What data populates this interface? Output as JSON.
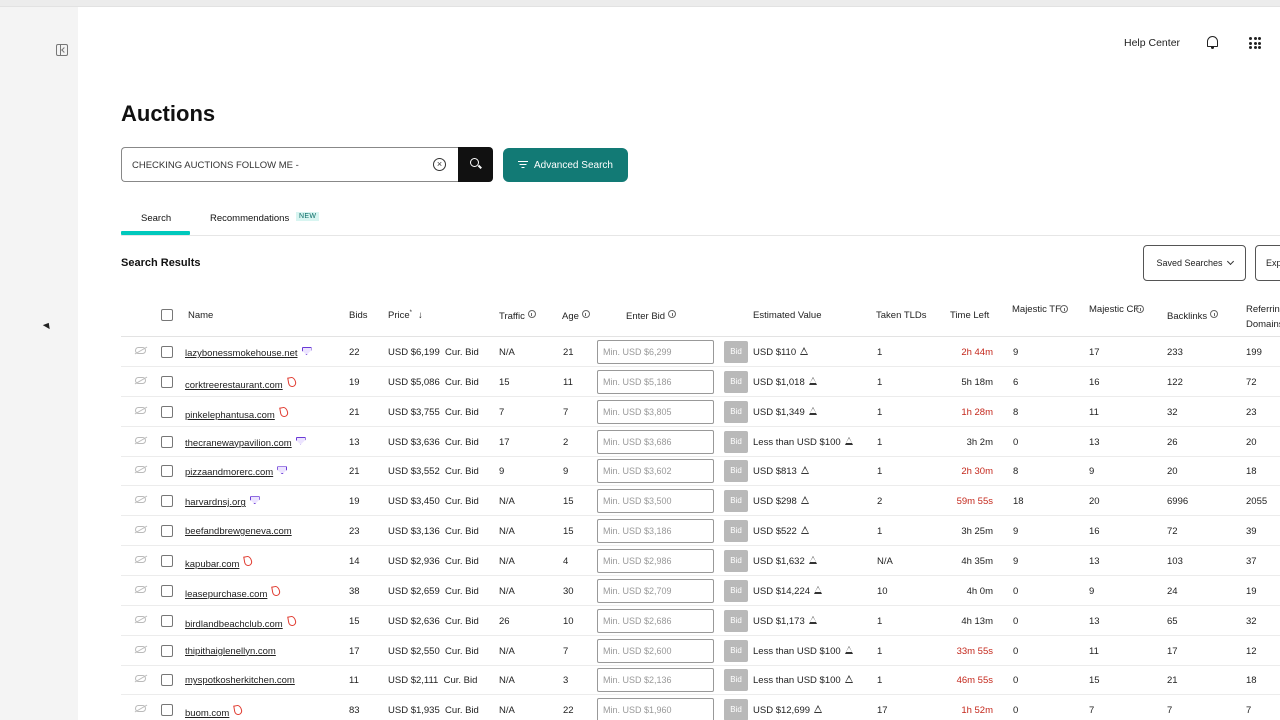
{
  "topbar": {
    "help_label": "Help Center"
  },
  "page": {
    "title": "Auctions"
  },
  "search": {
    "value": "CHECKING AUCTIONS FOLLOW ME -",
    "clear_glyph": "×"
  },
  "advanced_search_label": "Advanced Search",
  "tabs": [
    {
      "label": "Search",
      "active": true
    },
    {
      "label": "Recommendations",
      "badge": "NEW"
    }
  ],
  "results": {
    "title": "Search Results",
    "saved_searches_label": "Saved Searches",
    "export_label": "Exp"
  },
  "columns": {
    "name": "Name",
    "bids": "Bids",
    "price": "Price",
    "price_marker": "*",
    "traffic": "Traffic",
    "age": "Age",
    "enter_bid": "Enter Bid",
    "estimated_value": "Estimated Value",
    "taken_tlds": "Taken TLDs",
    "time_left": "Time Left",
    "majestic_tf": "Majestic TF",
    "majestic_cf": "Majestic CF",
    "backlinks": "Backlinks",
    "referring_domains": "Referring Domains"
  },
  "bid_button_label": "Bid",
  "cur_bid_label": "Cur. Bid",
  "colors": {
    "accent": "#127a75",
    "tab_underline": "#00c9bd",
    "urgent": "#c4281c"
  },
  "rows": [
    {
      "domain": "lazybonessmokehouse.net",
      "icon": "diamond-icon",
      "bids": "22",
      "price": "USD $6,199",
      "traffic": "N/A",
      "age": "21",
      "min_bid": "Min. USD $6,299",
      "est_value": "USD $110",
      "taken_tlds": "1",
      "time_left": "2h 44m",
      "urgent": true,
      "tf": "9",
      "cf": "17",
      "backlinks": "233",
      "ref_domains": "199"
    },
    {
      "domain": "corktreerestaurant.com",
      "icon": "fire-icon",
      "bids": "19",
      "price": "USD $5,086",
      "traffic": "15",
      "age": "11",
      "min_bid": "Min. USD $5,186",
      "est_value": "USD $1,018",
      "taken_tlds": "1",
      "time_left": "5h 18m",
      "urgent": false,
      "tf": "6",
      "cf": "16",
      "backlinks": "122",
      "ref_domains": "72"
    },
    {
      "domain": "pinkelephantusa.com",
      "icon": "fire-icon",
      "bids": "21",
      "price": "USD $3,755",
      "traffic": "7",
      "age": "7",
      "min_bid": "Min. USD $3,805",
      "est_value": "USD $1,349",
      "taken_tlds": "1",
      "time_left": "1h 28m",
      "urgent": true,
      "tf": "8",
      "cf": "11",
      "backlinks": "32",
      "ref_domains": "23"
    },
    {
      "domain": "thecranewaypavilion.com",
      "icon": "diamond-icon",
      "bids": "13",
      "price": "USD $3,636",
      "traffic": "17",
      "age": "2",
      "min_bid": "Min. USD $3,686",
      "est_value": "Less than USD $100",
      "taken_tlds": "1",
      "time_left": "3h 2m",
      "urgent": false,
      "tf": "0",
      "cf": "13",
      "backlinks": "26",
      "ref_domains": "20"
    },
    {
      "domain": "pizzaandmorerc.com",
      "icon": "diamond-icon",
      "bids": "21",
      "price": "USD $3,552",
      "traffic": "9",
      "age": "9",
      "min_bid": "Min. USD $3,602",
      "est_value": "USD $813",
      "taken_tlds": "1",
      "time_left": "2h 30m",
      "urgent": true,
      "tf": "8",
      "cf": "9",
      "backlinks": "20",
      "ref_domains": "18"
    },
    {
      "domain": "harvardnsj.org",
      "icon": "diamond-icon",
      "bids": "19",
      "price": "USD $3,450",
      "traffic": "N/A",
      "age": "15",
      "min_bid": "Min. USD $3,500",
      "est_value": "USD $298",
      "taken_tlds": "2",
      "time_left": "59m 55s",
      "urgent": true,
      "tf": "18",
      "cf": "20",
      "backlinks": "6996",
      "ref_domains": "2055"
    },
    {
      "domain": "beefandbrewgeneva.com",
      "icon": "",
      "bids": "23",
      "price": "USD $3,136",
      "traffic": "N/A",
      "age": "15",
      "min_bid": "Min. USD $3,186",
      "est_value": "USD $522",
      "taken_tlds": "1",
      "time_left": "3h 25m",
      "urgent": false,
      "tf": "9",
      "cf": "16",
      "backlinks": "72",
      "ref_domains": "39"
    },
    {
      "domain": "kapubar.com",
      "icon": "fire-icon",
      "bids": "14",
      "price": "USD $2,936",
      "traffic": "N/A",
      "age": "4",
      "min_bid": "Min. USD $2,986",
      "est_value": "USD $1,632",
      "taken_tlds": "N/A",
      "time_left": "4h 35m",
      "urgent": false,
      "tf": "9",
      "cf": "13",
      "backlinks": "103",
      "ref_domains": "37"
    },
    {
      "domain": "leasepurchase.com",
      "icon": "fire-icon",
      "bids": "38",
      "price": "USD $2,659",
      "traffic": "N/A",
      "age": "30",
      "min_bid": "Min. USD $2,709",
      "est_value": "USD $14,224",
      "taken_tlds": "10",
      "time_left": "4h 0m",
      "urgent": false,
      "tf": "0",
      "cf": "9",
      "backlinks": "24",
      "ref_domains": "19"
    },
    {
      "domain": "birdlandbeachclub.com",
      "icon": "fire-icon",
      "bids": "15",
      "price": "USD $2,636",
      "traffic": "26",
      "age": "10",
      "min_bid": "Min. USD $2,686",
      "est_value": "USD $1,173",
      "taken_tlds": "1",
      "time_left": "4h 13m",
      "urgent": false,
      "tf": "0",
      "cf": "13",
      "backlinks": "65",
      "ref_domains": "32"
    },
    {
      "domain": "thipithaiglenellyn.com",
      "icon": "",
      "bids": "17",
      "price": "USD $2,550",
      "traffic": "N/A",
      "age": "7",
      "min_bid": "Min. USD $2,600",
      "est_value": "Less than USD $100",
      "taken_tlds": "1",
      "time_left": "33m 55s",
      "urgent": true,
      "tf": "0",
      "cf": "11",
      "backlinks": "17",
      "ref_domains": "12"
    },
    {
      "domain": "myspotkosherkitchen.com",
      "icon": "",
      "bids": "11",
      "price": "USD $2,111",
      "traffic": "N/A",
      "age": "3",
      "min_bid": "Min. USD $2,136",
      "est_value": "Less than USD $100",
      "taken_tlds": "1",
      "time_left": "46m 55s",
      "urgent": true,
      "tf": "0",
      "cf": "15",
      "backlinks": "21",
      "ref_domains": "18"
    },
    {
      "domain": "buom.com",
      "icon": "fire-icon",
      "bids": "83",
      "price": "USD $1,935",
      "traffic": "N/A",
      "age": "22",
      "min_bid": "Min. USD $1,960",
      "est_value": "USD $12,699",
      "taken_tlds": "17",
      "time_left": "1h 52m",
      "urgent": true,
      "tf": "0",
      "cf": "7",
      "backlinks": "7",
      "ref_domains": "7"
    }
  ]
}
